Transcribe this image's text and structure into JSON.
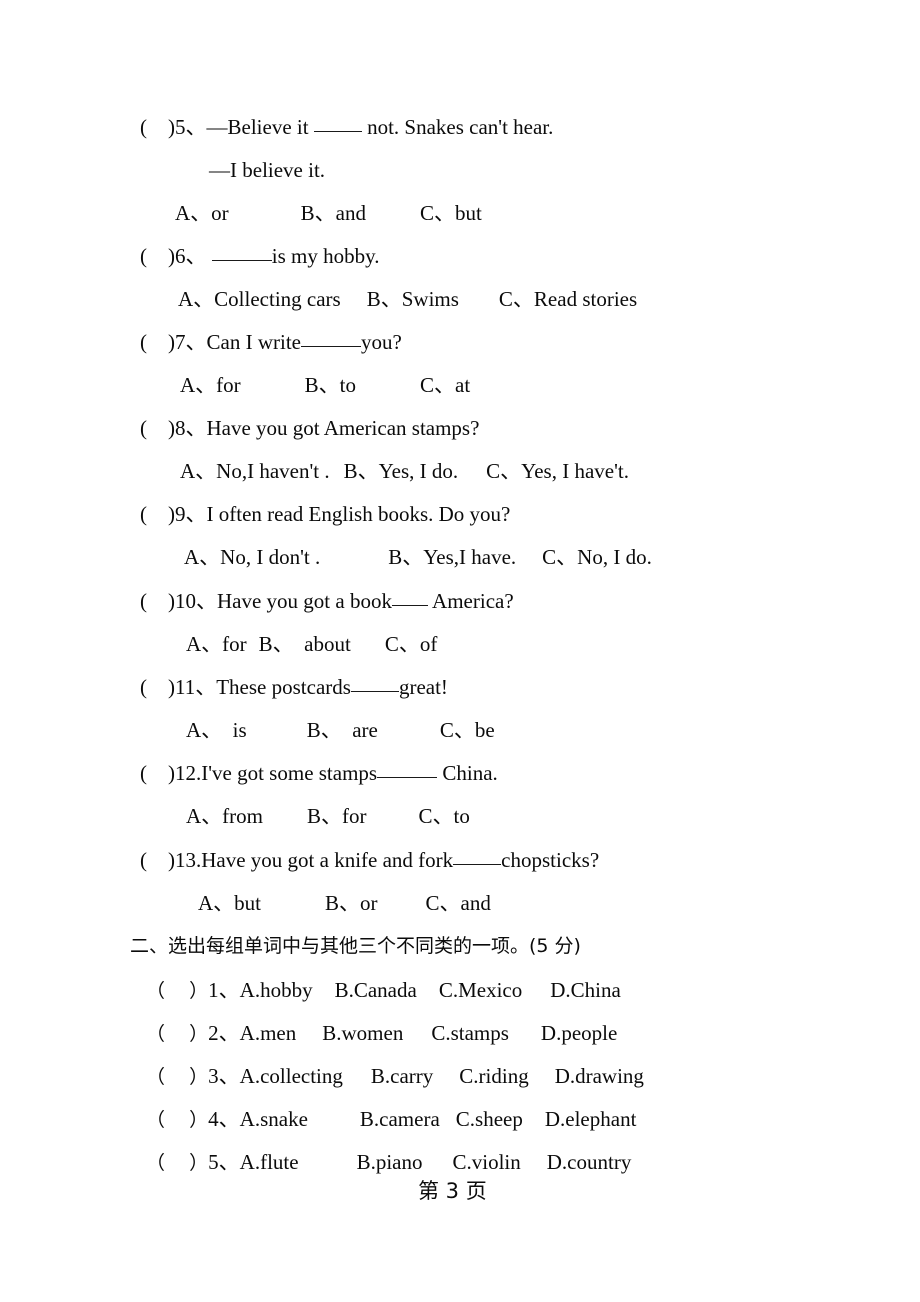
{
  "document": {
    "page_label_prefix": "第",
    "page_number": "3",
    "page_label_suffix": "页",
    "footer_text": "第 3 页"
  },
  "section_one": {
    "questions": [
      {
        "bracket": "(    )",
        "number": "5、",
        "stem_before": "—Believe it ",
        "blank": "w4",
        "stem_after": " not. Snakes can't hear.",
        "continuation": "—I believe it.",
        "options": [
          "A、or",
          "B、and",
          "C、but"
        ]
      },
      {
        "bracket": "(    )",
        "number": "6、",
        "stem_before": " ",
        "blank": "w5",
        "stem_after": "is my hobby.",
        "continuation": null,
        "options": [
          "A、Collecting cars",
          "B、Swims",
          "C、Read stories"
        ]
      },
      {
        "bracket": "(    )",
        "number": "7、",
        "stem_before": "Can I write",
        "blank": "w5",
        "stem_after": "you?",
        "continuation": null,
        "options": [
          "A、for",
          "B、to",
          "C、at"
        ]
      },
      {
        "bracket": "(    )",
        "number": "8、",
        "stem_before": "Have you got American stamps?",
        "blank": null,
        "stem_after": "",
        "continuation": null,
        "options": [
          "A、No,I haven't .",
          "B、Yes, I do.",
          "C、Yes, I have't."
        ]
      },
      {
        "bracket": "(    )",
        "number": "9、",
        "stem_before": "I often read English books. Do you?",
        "blank": null,
        "stem_after": "",
        "continuation": null,
        "options": [
          "A、No, I don't .",
          "B、Yes,I have.",
          "C、No, I do."
        ]
      },
      {
        "bracket": "(    )",
        "number": "10、",
        "stem_before": "Have you got a book",
        "blank": "w3",
        "stem_after": " America?",
        "continuation": null,
        "options": [
          "A、for",
          "B、  about",
          "C、of"
        ]
      },
      {
        "bracket": "(    )",
        "number": "11、",
        "stem_before": "These postcards",
        "blank": "w4",
        "stem_after": "great!",
        "continuation": null,
        "options": [
          "A、  is",
          "B、  are",
          "C、be"
        ]
      },
      {
        "bracket": "(    )",
        "number": "12.",
        "stem_before": "I've got some stamps",
        "blank": "w5",
        "stem_after": " China.",
        "continuation": null,
        "options": [
          "A、from",
          "B、for",
          "C、to"
        ]
      },
      {
        "bracket": "(    )",
        "number": "13.",
        "stem_before": "Have you got a knife and fork",
        "blank": "w4",
        "stem_after": "chopsticks?",
        "continuation": null,
        "options": [
          "A、but",
          "B、or",
          "C、and"
        ]
      }
    ]
  },
  "section_two": {
    "heading": "二、选出每组单词中与其他三个不同类的一项。(5 分)",
    "heading_number": "二、",
    "heading_text": "选出每组单词中与其他三个不同类的一项。",
    "heading_score": "(5 分)",
    "items": [
      {
        "bracket": "（    ）",
        "number": "1、",
        "options": [
          "A.hobby",
          "B.Canada",
          "C.Mexico",
          "D.China"
        ]
      },
      {
        "bracket": "（    ）",
        "number": "2、",
        "options": [
          "A.men",
          "B.women",
          "C.stamps",
          "D.people"
        ]
      },
      {
        "bracket": "（    ）",
        "number": "3、",
        "options": [
          "A.collecting",
          "B.carry",
          "C.riding",
          "D.drawing"
        ]
      },
      {
        "bracket": "（    ）",
        "number": "4、",
        "options": [
          "A.snake",
          "B.camera",
          "C.sheep",
          "D.elephant"
        ]
      },
      {
        "bracket": "（    ）",
        "number": "5、",
        "options": [
          "A.flute",
          "B.piano",
          "C.violin",
          "D.country"
        ]
      }
    ]
  },
  "colors": {
    "text": "#0b0b0b",
    "background": "#ffffff",
    "rule": "#1a1a1a"
  }
}
